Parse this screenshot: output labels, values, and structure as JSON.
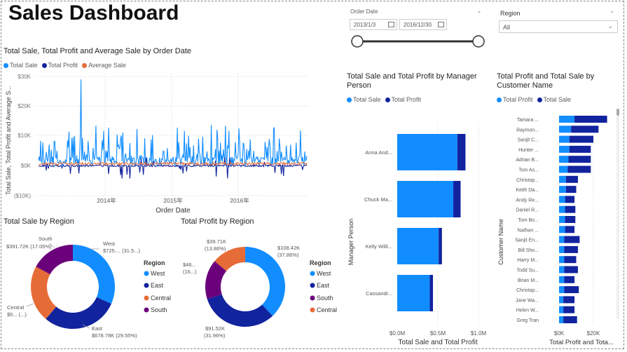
{
  "title": "Sales Dashboard",
  "colors": {
    "total_sale": "#118dff",
    "total_profit": "#12239e",
    "average_sale": "#e66c37",
    "south": "#6b007b",
    "central": "#e66c37"
  },
  "slicers": {
    "date_label": "Order Date",
    "date_start": "2013/1/3",
    "date_end": "2016/12/30",
    "date_range_fraction": [
      0,
      1
    ],
    "region_label": "Region",
    "region_value": "All"
  },
  "line_chart": {
    "title": "Total Sale, Total Profit and Average Sale by Order Date",
    "legend": [
      "Total Sale",
      "Total Profit",
      "Average Sale"
    ],
    "ylabel": "Total Sale, Total Profit and Average S...",
    "xlabel": "Order Date",
    "yticks": [
      "$30K",
      "$20K",
      "$10K",
      "$0K",
      "($10K)"
    ],
    "xticks": [
      "2014年",
      "2015年",
      "2016年"
    ]
  },
  "bar_manager": {
    "title_line1": "Total Sale and Total Profit by Manager",
    "title_line2": "Person",
    "legend": [
      "Total Sale",
      "Total Profit"
    ],
    "ylabel": "Manager Person",
    "xlabel": "Total Sale and Total Profit",
    "xticks": [
      "$0.0M",
      "$0.5M",
      "$1.0M"
    ],
    "categories": [
      "Anna And...",
      "Chuck Ma...",
      "Kelly Willi...",
      "Cassandr..."
    ]
  },
  "bar_customer": {
    "title_line1": "Total Profit and Total Sale by",
    "title_line2": "Customer Name",
    "legend": [
      "Total Profit",
      "Total Sale"
    ],
    "ylabel": "Customer Name",
    "xlabel": "Total Profit and Tota...",
    "xticks": [
      "$0K",
      "$20K"
    ],
    "categories": [
      "Tamara ...",
      "Raymon...",
      "Sanjit C...",
      "Hunter ...",
      "Adrian B...",
      "Tom As...",
      "Christop...",
      "Keith Da...",
      "Andy Re...",
      "Daniel R...",
      "Tom Bo...",
      "Nathan ...",
      "Sanjit En...",
      "Bill Sho...",
      "Harry M...",
      "Todd Su...",
      "Brian M...",
      "Christop...",
      "Jane Wa...",
      "Helen W...",
      "Greg Tran"
    ]
  },
  "donut_sale": {
    "title": "Total Sale by Region",
    "legend_title": "Region",
    "legend": [
      "West",
      "East",
      "Central",
      "South"
    ],
    "labels": {
      "west": "West",
      "west_val": "$725.... (31.5...)",
      "south": "South",
      "south_val": "$391.72K (17.05%)",
      "central": "Central",
      "central_val": "$5... (...)",
      "east": "East",
      "east_val": "$678.78K (29.55%)"
    }
  },
  "donut_profit": {
    "title": "Total Profit by Region",
    "legend_title": "Region",
    "legend": [
      "West",
      "East",
      "South",
      "Central"
    ],
    "labels": {
      "a1": "$39.71K",
      "a2": "(13.86%)",
      "b1": "$108.42K",
      "b2": "(37.86%)",
      "c1": "$46...",
      "c2": "(16...)",
      "d1": "$91.52K",
      "d2": "(31.96%)"
    }
  },
  "chart_data": [
    {
      "type": "line",
      "title": "Total Sale, Total Profit and Average Sale by Order Date",
      "xlabel": "Order Date",
      "ylabel": "Total Sale, Total Profit and Average S...",
      "ylim": [
        -10000,
        30000
      ],
      "series": [
        {
          "name": "Total Sale"
        },
        {
          "name": "Total Profit"
        },
        {
          "name": "Average Sale"
        }
      ]
    },
    {
      "type": "bar",
      "title": "Total Sale and Total Profit by Manager Person",
      "categories": [
        "Anna And...",
        "Chuck Ma...",
        "Kelly Willi...",
        "Cassandr..."
      ],
      "series": [
        {
          "name": "Total Sale",
          "values": [
            740000,
            690000,
            510000,
            400000
          ]
        },
        {
          "name": "Total Profit",
          "values": [
            100000,
            90000,
            40000,
            40000
          ]
        }
      ],
      "xlabel": "Total Sale and Total Profit",
      "ylabel": "Manager Person",
      "xlim": [
        0,
        1000000
      ]
    },
    {
      "type": "bar",
      "title": "Total Profit and Total Sale by Customer Name",
      "categories": [
        "Tamara ...",
        "Raymon...",
        "Sanjit C...",
        "Hunter ...",
        "Adrian B...",
        "Tom As...",
        "Christop...",
        "Keith Da...",
        "Andy Re...",
        "Daniel R...",
        "Tom Bo...",
        "Nathan ...",
        "Sanjit En...",
        "Bill Sho...",
        "Harry M...",
        "Todd Su...",
        "Brian M...",
        "Christop...",
        "Jane Wa...",
        "Helen W...",
        "Greg Tran"
      ],
      "series": [
        {
          "name": "Total Profit",
          "values": [
            9000,
            7000,
            6000,
            6000,
            5500,
            5000,
            4000,
            4000,
            3500,
            3500,
            3500,
            3500,
            3000,
            3000,
            3000,
            3000,
            3000,
            3000,
            2500,
            2500,
            2500
          ]
        },
        {
          "name": "Total Sale",
          "values": [
            19000,
            16000,
            14000,
            12500,
            13000,
            13500,
            7000,
            6000,
            5500,
            6000,
            6000,
            5500,
            9000,
            8000,
            7000,
            8000,
            6000,
            8500,
            6500,
            6500,
            8000
          ]
        }
      ],
      "xlabel": "Total Profit and Tota...",
      "ylabel": "Customer Name",
      "xlim": [
        0,
        30000
      ]
    },
    {
      "type": "pie",
      "title": "Total Sale by Region",
      "categories": [
        "West",
        "East",
        "Central",
        "South"
      ],
      "values": [
        725000,
        678780,
        501000,
        391720
      ],
      "percent": [
        31.5,
        29.55,
        21.9,
        17.05
      ]
    },
    {
      "type": "pie",
      "title": "Total Profit by Region",
      "categories": [
        "West",
        "East",
        "South",
        "Central"
      ],
      "values": [
        108420,
        91520,
        46000,
        39710
      ],
      "percent": [
        37.86,
        31.96,
        16.3,
        13.86
      ]
    }
  ]
}
